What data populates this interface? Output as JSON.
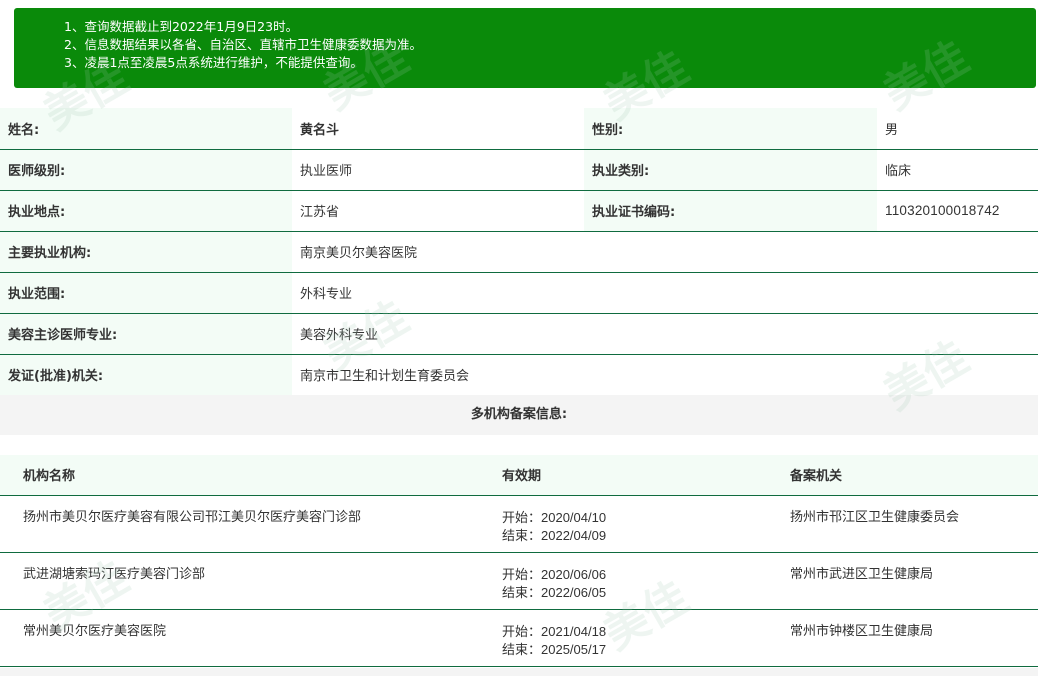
{
  "notice": {
    "line1": "1、查询数据截止到2022年1月9日23时。",
    "line2": "2、信息数据结果以各省、自治区、直辖市卫生健康委数据为准。",
    "line3": "3、凌晨1点至凌晨5点系统进行维护，不能提供查询。"
  },
  "profile": {
    "name_label": "姓名:",
    "name_value": "黄名斗",
    "gender_label": "性别:",
    "gender_value": "男",
    "level_label": "医师级别:",
    "level_value": "执业医师",
    "category_label": "执业类别:",
    "category_value": "临床",
    "location_label": "执业地点:",
    "location_value": "江苏省",
    "cert_label": "执业证书编码:",
    "cert_value": "110320100018742",
    "org_label": "主要执业机构:",
    "org_value": "南京美贝尔美容医院",
    "scope_label": "执业范围:",
    "scope_value": "外科专业",
    "specialty_label": "美容主诊医师专业:",
    "specialty_value": "美容外科专业",
    "issuer_label": "发证(批准)机关:",
    "issuer_value": "南京市卫生和计划生育委员会"
  },
  "multi": {
    "title": "多机构备案信息:",
    "headers": {
      "name": "机构名称",
      "validity": "有效期",
      "authority": "备案机关"
    },
    "rows": [
      {
        "name": "扬州市美贝尔医疗美容有限公司邗江美贝尔医疗美容门诊部",
        "start": "开始：2020/04/10",
        "end": "结束：2022/04/09",
        "authority": "扬州市邗江区卫生健康委员会"
      },
      {
        "name": "武进湖塘索玛汀医疗美容门诊部",
        "start": "开始：2020/06/06",
        "end": "结束：2022/06/05",
        "authority": "常州市武进区卫生健康局"
      },
      {
        "name": "常州美贝尔医疗美容医院",
        "start": "开始：2021/04/18",
        "end": "结束：2025/05/17",
        "authority": "常州市钟楼区卫生健康局"
      }
    ]
  },
  "watermark": {
    "text": "美佳"
  }
}
